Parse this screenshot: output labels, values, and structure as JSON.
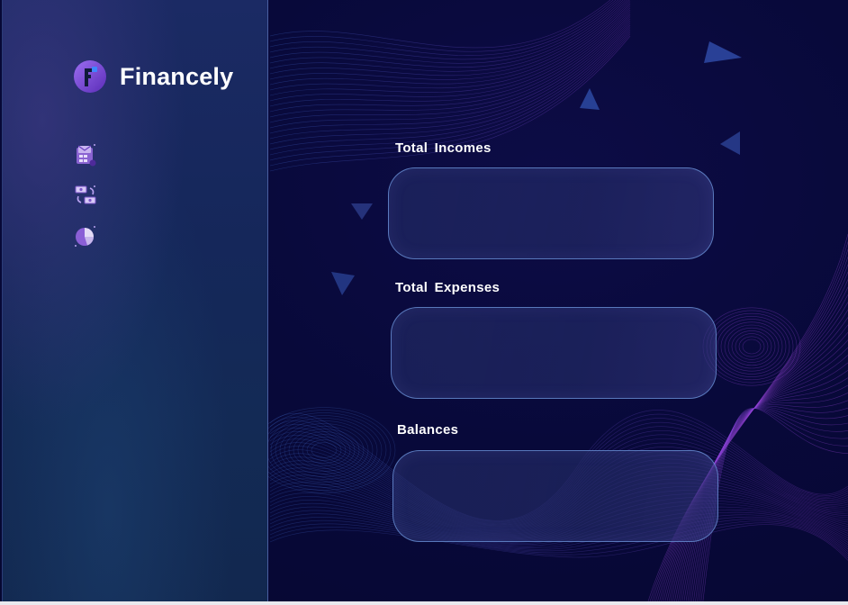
{
  "app": {
    "name": "Financely"
  },
  "sidebar": {
    "items": [
      {
        "icon": "calculator-money-icon"
      },
      {
        "icon": "money-exchange-icon"
      },
      {
        "icon": "pie-chart-icon"
      }
    ]
  },
  "main": {
    "cards": [
      {
        "title": "Total  Incomes",
        "value": ""
      },
      {
        "title": "Total  Expenses",
        "value": ""
      },
      {
        "title": "Balances",
        "value": ""
      }
    ]
  },
  "colors": {
    "background": "#08093a",
    "sidebar": "#17295c",
    "accent": "#7b4fd1",
    "card_border": "#6e96dc"
  }
}
